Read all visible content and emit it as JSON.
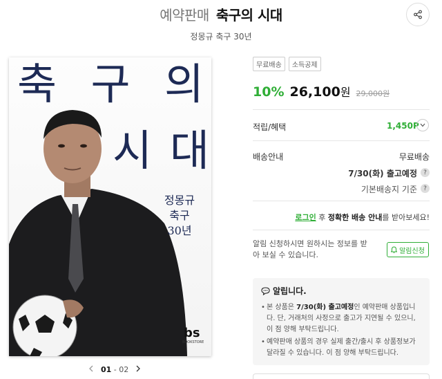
{
  "header": {
    "prefix": "예약판매",
    "title": "축구의 시대",
    "subtitle": "정몽규 축구 30년"
  },
  "cover": {
    "row1": [
      "축",
      "구",
      "의"
    ],
    "row2": [
      "시",
      "대"
    ],
    "sub_lines": [
      "정몽규",
      "축구",
      "30년"
    ],
    "logo": "bs",
    "logo_sub": "BOOKSTORE"
  },
  "pager": {
    "current": "01",
    "separator": " - ",
    "total": "02"
  },
  "badges": [
    "무료배송",
    "소득공제"
  ],
  "price": {
    "discount": "10%",
    "amount": "26,100",
    "unit": "원",
    "original": "29,000원"
  },
  "points": {
    "label": "적립/혜택",
    "value": "1,450P"
  },
  "shipping": {
    "label": "배송안내",
    "fee": "무료배송",
    "schedule": "7/30(화) 출고예정",
    "address": "기본배송지 기준"
  },
  "login_notice": {
    "link": "로그인",
    "mid": " 후 ",
    "bold": "정확한 배송 안내",
    "tail": "를 받아보세요!"
  },
  "notify": {
    "text": "알림 신청하시면 원하시는 정보를 받아 보실 수 있습니다.",
    "button": "알림신청"
  },
  "notice": {
    "title": "알립니다.",
    "item1_pre": "본 상품은 ",
    "item1_bold": "7/30(화) 출고예정",
    "item1_post": "인 예약판매 상품입니다. 단, 거래처의 사정으로 출고가 지연될 수 있으니, 이 점 양해 부탁드립니다.",
    "item2": "예약판매 상품의 경우 실제 출간/출시 후 상품정보가 달라질 수 있습니다. 이 점 양해 부탁드립니다."
  },
  "colors": {
    "accent": "#2fae36",
    "cover_text": "#1d2a55"
  }
}
